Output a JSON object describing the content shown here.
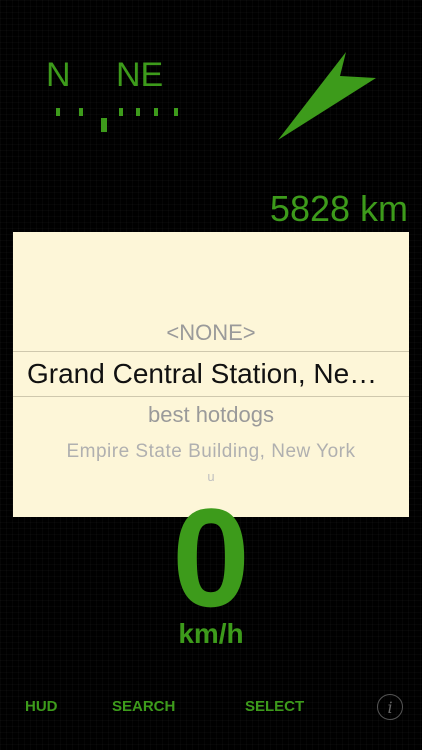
{
  "compass": {
    "heading_left": "N",
    "heading_right": "NE"
  },
  "distance": "5828 km",
  "picker": {
    "items": [
      "<NONE>",
      "Grand Central Station, New York",
      "best hotdogs",
      "Empire State Building, New York",
      "u"
    ],
    "selected_index": 1
  },
  "speed": {
    "value": "0",
    "unit": "km/h"
  },
  "toolbar": {
    "hud": "HUD",
    "search": "SEARCH",
    "select": "SELECT",
    "info": "i"
  },
  "colors": {
    "accent": "#3d9b1b",
    "background": "#000000",
    "picker_bg": "#fdf6d8"
  }
}
